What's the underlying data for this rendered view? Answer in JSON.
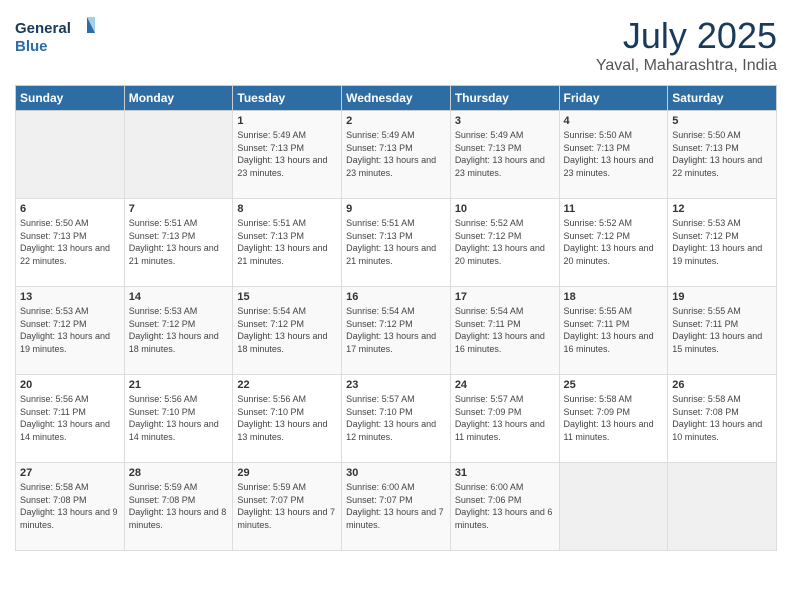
{
  "header": {
    "logo_line1": "General",
    "logo_line2": "Blue",
    "month_year": "July 2025",
    "location": "Yaval, Maharashtra, India"
  },
  "weekdays": [
    "Sunday",
    "Monday",
    "Tuesday",
    "Wednesday",
    "Thursday",
    "Friday",
    "Saturday"
  ],
  "weeks": [
    [
      {
        "day": "",
        "sunrise": "",
        "sunset": "",
        "daylight": ""
      },
      {
        "day": "",
        "sunrise": "",
        "sunset": "",
        "daylight": ""
      },
      {
        "day": "1",
        "sunrise": "Sunrise: 5:49 AM",
        "sunset": "Sunset: 7:13 PM",
        "daylight": "Daylight: 13 hours and 23 minutes."
      },
      {
        "day": "2",
        "sunrise": "Sunrise: 5:49 AM",
        "sunset": "Sunset: 7:13 PM",
        "daylight": "Daylight: 13 hours and 23 minutes."
      },
      {
        "day": "3",
        "sunrise": "Sunrise: 5:49 AM",
        "sunset": "Sunset: 7:13 PM",
        "daylight": "Daylight: 13 hours and 23 minutes."
      },
      {
        "day": "4",
        "sunrise": "Sunrise: 5:50 AM",
        "sunset": "Sunset: 7:13 PM",
        "daylight": "Daylight: 13 hours and 23 minutes."
      },
      {
        "day": "5",
        "sunrise": "Sunrise: 5:50 AM",
        "sunset": "Sunset: 7:13 PM",
        "daylight": "Daylight: 13 hours and 22 minutes."
      }
    ],
    [
      {
        "day": "6",
        "sunrise": "Sunrise: 5:50 AM",
        "sunset": "Sunset: 7:13 PM",
        "daylight": "Daylight: 13 hours and 22 minutes."
      },
      {
        "day": "7",
        "sunrise": "Sunrise: 5:51 AM",
        "sunset": "Sunset: 7:13 PM",
        "daylight": "Daylight: 13 hours and 21 minutes."
      },
      {
        "day": "8",
        "sunrise": "Sunrise: 5:51 AM",
        "sunset": "Sunset: 7:13 PM",
        "daylight": "Daylight: 13 hours and 21 minutes."
      },
      {
        "day": "9",
        "sunrise": "Sunrise: 5:51 AM",
        "sunset": "Sunset: 7:13 PM",
        "daylight": "Daylight: 13 hours and 21 minutes."
      },
      {
        "day": "10",
        "sunrise": "Sunrise: 5:52 AM",
        "sunset": "Sunset: 7:12 PM",
        "daylight": "Daylight: 13 hours and 20 minutes."
      },
      {
        "day": "11",
        "sunrise": "Sunrise: 5:52 AM",
        "sunset": "Sunset: 7:12 PM",
        "daylight": "Daylight: 13 hours and 20 minutes."
      },
      {
        "day": "12",
        "sunrise": "Sunrise: 5:53 AM",
        "sunset": "Sunset: 7:12 PM",
        "daylight": "Daylight: 13 hours and 19 minutes."
      }
    ],
    [
      {
        "day": "13",
        "sunrise": "Sunrise: 5:53 AM",
        "sunset": "Sunset: 7:12 PM",
        "daylight": "Daylight: 13 hours and 19 minutes."
      },
      {
        "day": "14",
        "sunrise": "Sunrise: 5:53 AM",
        "sunset": "Sunset: 7:12 PM",
        "daylight": "Daylight: 13 hours and 18 minutes."
      },
      {
        "day": "15",
        "sunrise": "Sunrise: 5:54 AM",
        "sunset": "Sunset: 7:12 PM",
        "daylight": "Daylight: 13 hours and 18 minutes."
      },
      {
        "day": "16",
        "sunrise": "Sunrise: 5:54 AM",
        "sunset": "Sunset: 7:12 PM",
        "daylight": "Daylight: 13 hours and 17 minutes."
      },
      {
        "day": "17",
        "sunrise": "Sunrise: 5:54 AM",
        "sunset": "Sunset: 7:11 PM",
        "daylight": "Daylight: 13 hours and 16 minutes."
      },
      {
        "day": "18",
        "sunrise": "Sunrise: 5:55 AM",
        "sunset": "Sunset: 7:11 PM",
        "daylight": "Daylight: 13 hours and 16 minutes."
      },
      {
        "day": "19",
        "sunrise": "Sunrise: 5:55 AM",
        "sunset": "Sunset: 7:11 PM",
        "daylight": "Daylight: 13 hours and 15 minutes."
      }
    ],
    [
      {
        "day": "20",
        "sunrise": "Sunrise: 5:56 AM",
        "sunset": "Sunset: 7:11 PM",
        "daylight": "Daylight: 13 hours and 14 minutes."
      },
      {
        "day": "21",
        "sunrise": "Sunrise: 5:56 AM",
        "sunset": "Sunset: 7:10 PM",
        "daylight": "Daylight: 13 hours and 14 minutes."
      },
      {
        "day": "22",
        "sunrise": "Sunrise: 5:56 AM",
        "sunset": "Sunset: 7:10 PM",
        "daylight": "Daylight: 13 hours and 13 minutes."
      },
      {
        "day": "23",
        "sunrise": "Sunrise: 5:57 AM",
        "sunset": "Sunset: 7:10 PM",
        "daylight": "Daylight: 13 hours and 12 minutes."
      },
      {
        "day": "24",
        "sunrise": "Sunrise: 5:57 AM",
        "sunset": "Sunset: 7:09 PM",
        "daylight": "Daylight: 13 hours and 11 minutes."
      },
      {
        "day": "25",
        "sunrise": "Sunrise: 5:58 AM",
        "sunset": "Sunset: 7:09 PM",
        "daylight": "Daylight: 13 hours and 11 minutes."
      },
      {
        "day": "26",
        "sunrise": "Sunrise: 5:58 AM",
        "sunset": "Sunset: 7:08 PM",
        "daylight": "Daylight: 13 hours and 10 minutes."
      }
    ],
    [
      {
        "day": "27",
        "sunrise": "Sunrise: 5:58 AM",
        "sunset": "Sunset: 7:08 PM",
        "daylight": "Daylight: 13 hours and 9 minutes."
      },
      {
        "day": "28",
        "sunrise": "Sunrise: 5:59 AM",
        "sunset": "Sunset: 7:08 PM",
        "daylight": "Daylight: 13 hours and 8 minutes."
      },
      {
        "day": "29",
        "sunrise": "Sunrise: 5:59 AM",
        "sunset": "Sunset: 7:07 PM",
        "daylight": "Daylight: 13 hours and 7 minutes."
      },
      {
        "day": "30",
        "sunrise": "Sunrise: 6:00 AM",
        "sunset": "Sunset: 7:07 PM",
        "daylight": "Daylight: 13 hours and 7 minutes."
      },
      {
        "day": "31",
        "sunrise": "Sunrise: 6:00 AM",
        "sunset": "Sunset: 7:06 PM",
        "daylight": "Daylight: 13 hours and 6 minutes."
      },
      {
        "day": "",
        "sunrise": "",
        "sunset": "",
        "daylight": ""
      },
      {
        "day": "",
        "sunrise": "",
        "sunset": "",
        "daylight": ""
      }
    ]
  ]
}
